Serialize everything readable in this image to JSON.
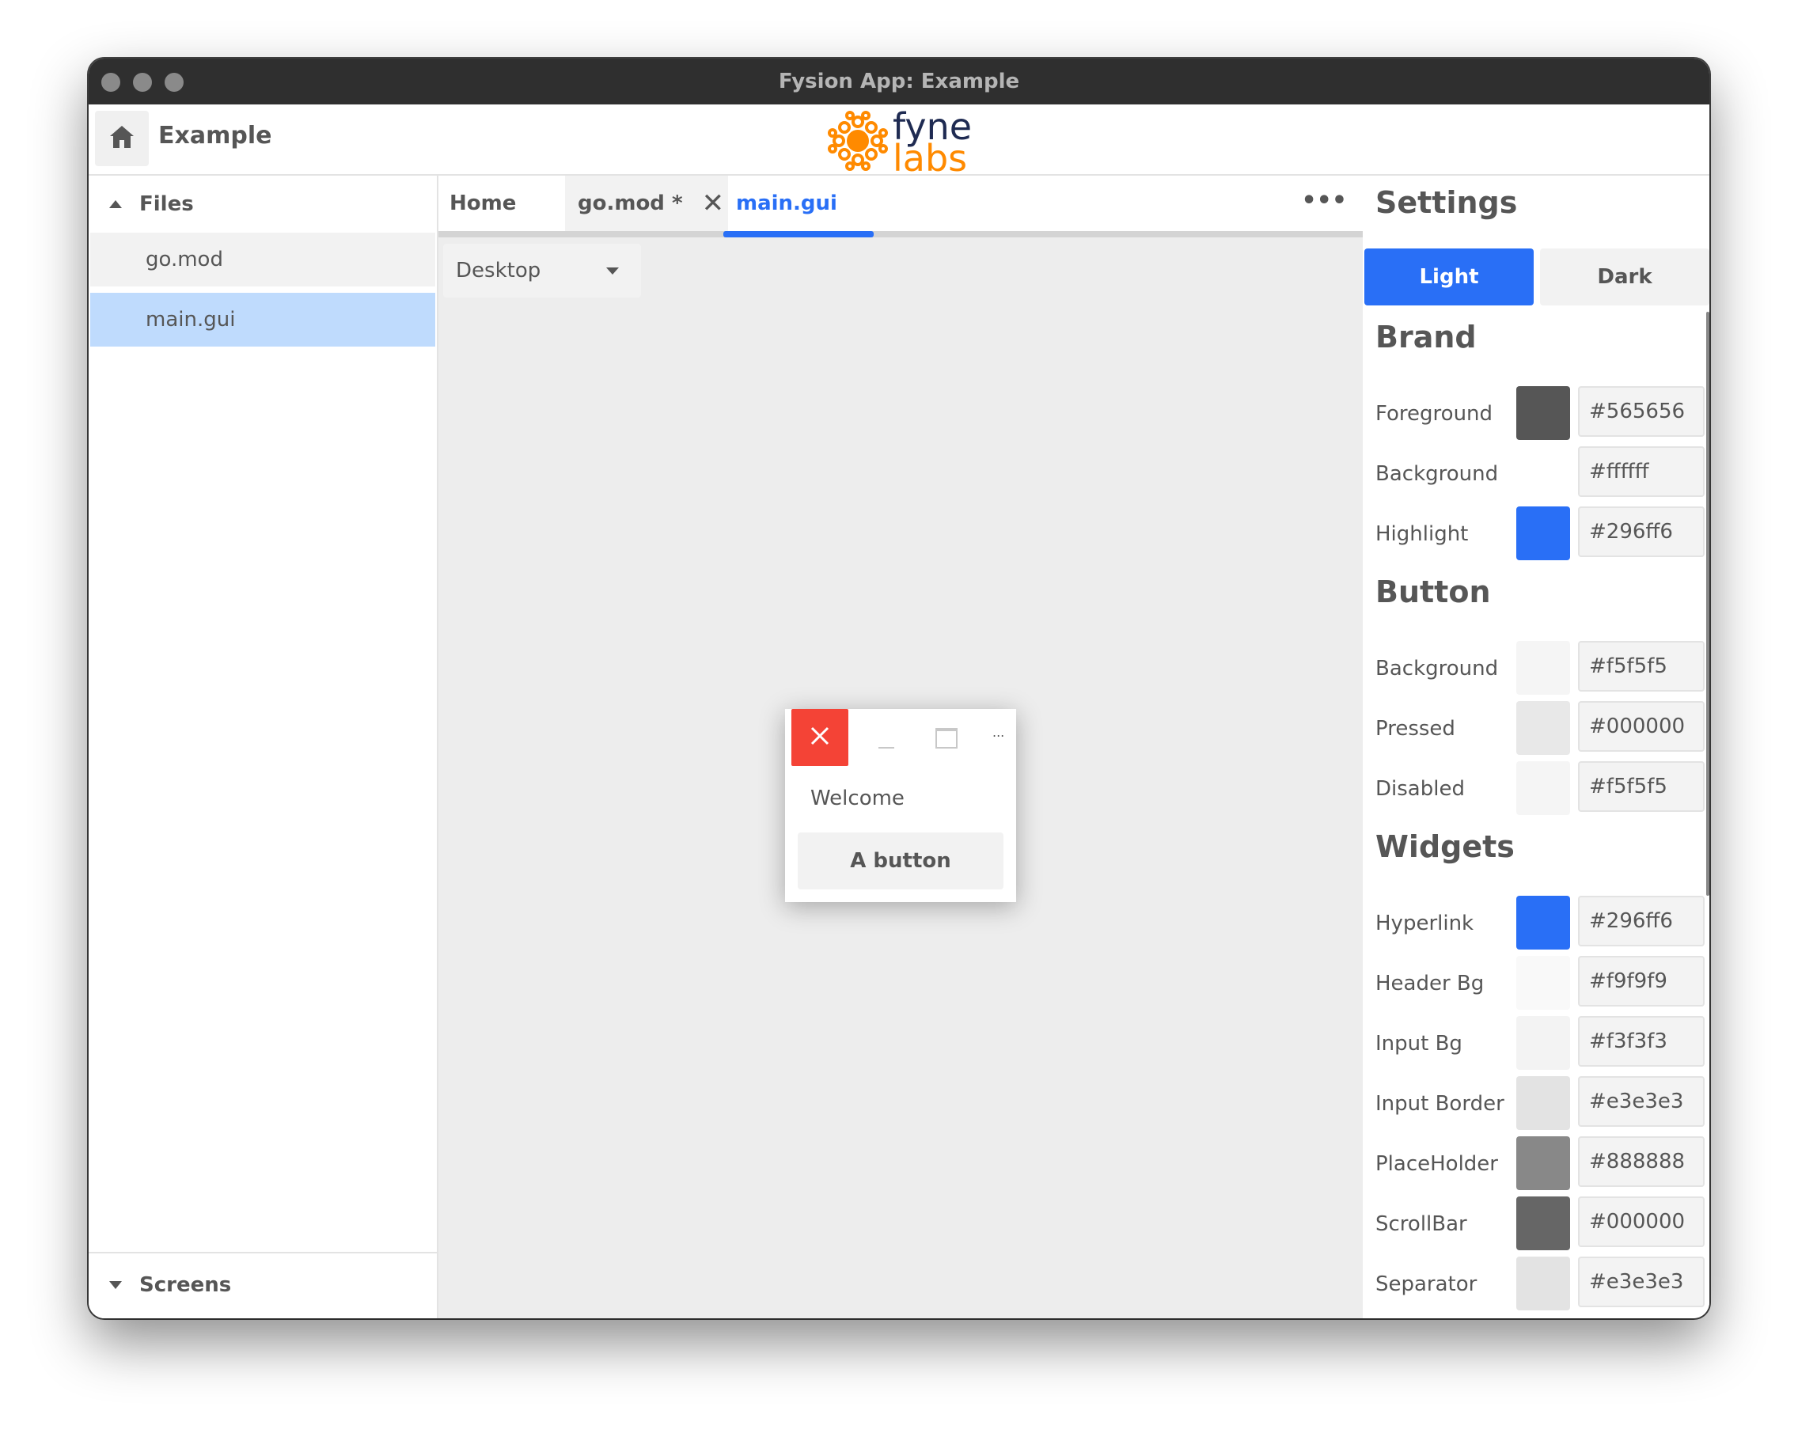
{
  "window": {
    "title": "Fysion App: Example"
  },
  "toolbar": {
    "project_name": "Example",
    "home_icon": "home-icon",
    "logo": {
      "line1": "fyne",
      "line2": "labs"
    }
  },
  "sidebar": {
    "files_header": "Files",
    "files": [
      {
        "label": "go.mod",
        "selected": false
      },
      {
        "label": "main.gui",
        "selected": true
      }
    ],
    "screens_header": "Screens"
  },
  "editor": {
    "tabs": [
      {
        "label": "Home"
      },
      {
        "label": "go.mod *",
        "closable": true
      },
      {
        "label": "main.gui",
        "active": true
      }
    ],
    "more_icon": "more-horizontal-icon",
    "device_select": "Desktop",
    "preview": {
      "label": "Welcome",
      "button": "A button",
      "more": "..."
    }
  },
  "settings": {
    "title": "Settings",
    "theme_light": "Light",
    "theme_dark": "Dark",
    "brand": {
      "title": "Brand",
      "rows": [
        {
          "label": "Foreground",
          "hex": "#565656",
          "swatch": "#565656"
        },
        {
          "label": "Background",
          "hex": "#ffffff",
          "swatch": "#ffffff"
        },
        {
          "label": "Highlight",
          "hex": "#296ff6",
          "swatch": "#296ff6"
        }
      ]
    },
    "button": {
      "title": "Button",
      "rows": [
        {
          "label": "Background",
          "hex": "#f5f5f5",
          "swatch": "#f5f5f5"
        },
        {
          "label": "Pressed",
          "hex": "#000000",
          "swatch": "#e8e8e8"
        },
        {
          "label": "Disabled",
          "hex": "#f5f5f5",
          "swatch": "#f5f5f5"
        }
      ]
    },
    "widgets": {
      "title": "Widgets",
      "rows": [
        {
          "label": "Hyperlink",
          "hex": "#296ff6",
          "swatch": "#296ff6"
        },
        {
          "label": "Header Bg",
          "hex": "#f9f9f9",
          "swatch": "#f9f9f9"
        },
        {
          "label": "Input Bg",
          "hex": "#f3f3f3",
          "swatch": "#f3f3f3"
        },
        {
          "label": "Input Border",
          "hex": "#e3e3e3",
          "swatch": "#e3e3e3"
        },
        {
          "label": "PlaceHolder",
          "hex": "#888888",
          "swatch": "#888888"
        },
        {
          "label": "ScrollBar",
          "hex": "#000000",
          "swatch": "#666666"
        },
        {
          "label": "Separator",
          "hex": "#e3e3e3",
          "swatch": "#e3e3e3"
        }
      ]
    }
  },
  "colors": {
    "accent": "#296ff6",
    "close": "#f44336",
    "selection": "#bfdbfd"
  }
}
